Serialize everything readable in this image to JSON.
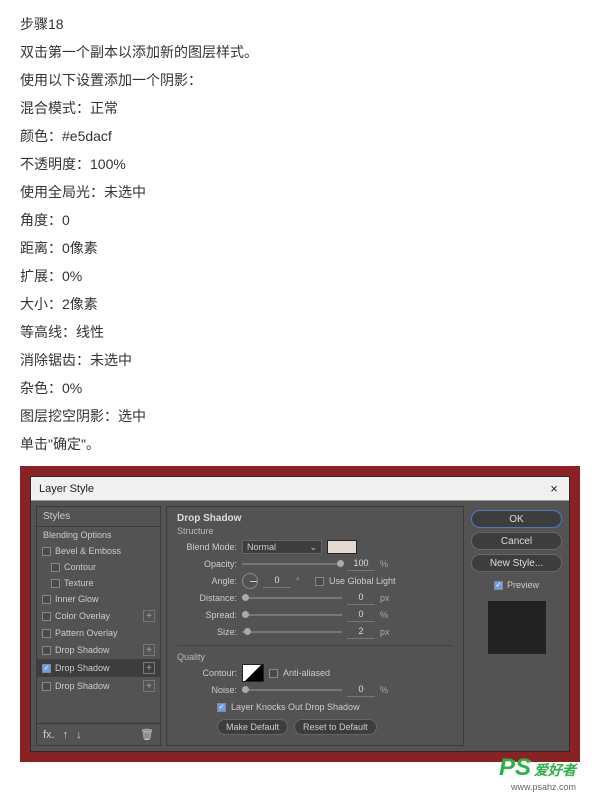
{
  "article": {
    "step_heading": "步骤18",
    "lines": [
      "双击第一个副本以添加新的图层样式。",
      "使用以下设置添加一个阴影：",
      "混合模式：正常",
      "颜色：#e5dacf",
      "不透明度：100%",
      "使用全局光：未选中",
      "角度：0",
      "距离：0像素",
      "扩展：0%",
      "大小：2像素",
      "等高线：线性",
      "消除锯齿：未选中",
      "杂色：0%",
      "图层挖空阴影：选中",
      "单击\"确定\"。"
    ]
  },
  "dialog": {
    "title": "Layer Style",
    "close": "×",
    "styles_header": "Styles",
    "blending_options": "Blending Options",
    "list": [
      {
        "label": "Bevel & Emboss",
        "checked": false,
        "plus": false,
        "indent": false
      },
      {
        "label": "Contour",
        "checked": false,
        "plus": false,
        "indent": true
      },
      {
        "label": "Texture",
        "checked": false,
        "plus": false,
        "indent": true
      },
      {
        "label": "Inner Glow",
        "checked": false,
        "plus": false,
        "indent": false
      },
      {
        "label": "Color Overlay",
        "checked": false,
        "plus": true,
        "indent": false
      },
      {
        "label": "Pattern Overlay",
        "checked": false,
        "plus": false,
        "indent": false
      },
      {
        "label": "Drop Shadow",
        "checked": false,
        "plus": true,
        "indent": false,
        "active": false
      },
      {
        "label": "Drop Shadow",
        "checked": true,
        "plus": true,
        "indent": false,
        "active": true
      },
      {
        "label": "Drop Shadow",
        "checked": false,
        "plus": true,
        "indent": false,
        "active": false
      }
    ],
    "fx_icon": "fx.",
    "trash_icon": "🗑",
    "center": {
      "title": "Drop Shadow",
      "sub": "Structure",
      "blend_label": "Blend Mode:",
      "blend_value": "Normal",
      "opacity_label": "Opacity:",
      "opacity_val": "100",
      "pct": "%",
      "angle_label": "Angle:",
      "angle_val": "0",
      "deg": "°",
      "global_label": "Use Global Light",
      "distance_label": "Distance:",
      "distance_val": "0",
      "px": "px",
      "spread_label": "Spread:",
      "spread_val": "0",
      "size_label": "Size:",
      "size_val": "2",
      "quality": "Quality",
      "contour_label": "Contour:",
      "anti_label": "Anti-aliased",
      "noise_label": "Noise:",
      "noise_val": "0",
      "knockout": "Layer Knocks Out Drop Shadow",
      "make_default": "Make Default",
      "reset_default": "Reset to Default"
    },
    "right": {
      "ok": "OK",
      "cancel": "Cancel",
      "new_style": "New Style...",
      "preview": "Preview"
    }
  },
  "watermark": {
    "ps": "PS",
    "cn": "爱好者",
    "url": "www.psahz.com"
  }
}
